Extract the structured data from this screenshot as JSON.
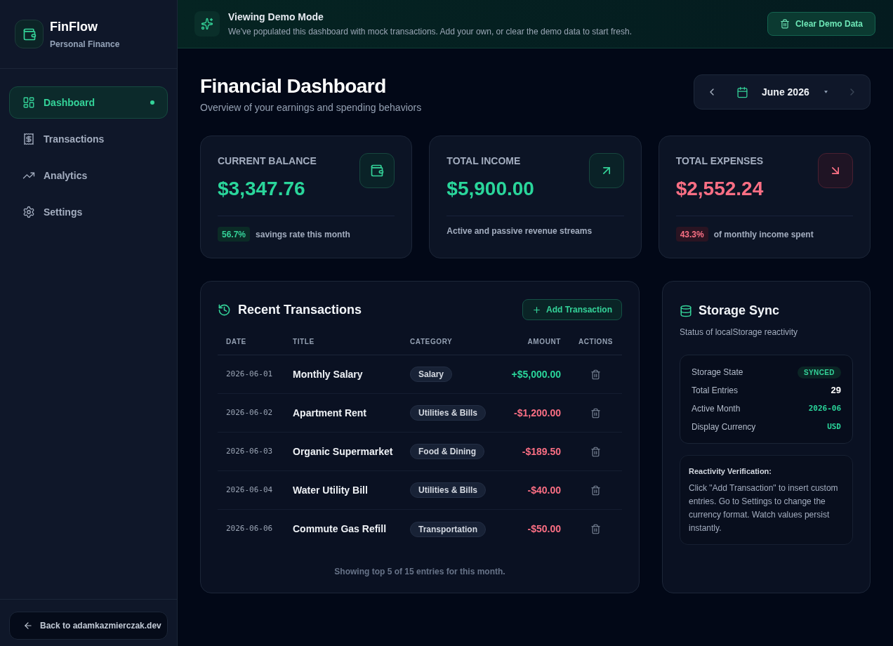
{
  "sidebar": {
    "brand": {
      "name": "FinFlow",
      "tagline": "Personal Finance"
    },
    "nav": [
      {
        "label": "Dashboard",
        "selected": true
      },
      {
        "label": "Transactions",
        "selected": false
      },
      {
        "label": "Analytics",
        "selected": false
      },
      {
        "label": "Settings",
        "selected": false
      }
    ],
    "back_link": "Back to adamkazmierczak.dev"
  },
  "banner": {
    "title": "Viewing Demo Mode",
    "message": "We've populated this dashboard with mock transactions. Add your own, or clear the demo data to start fresh.",
    "button": "Clear Demo Data"
  },
  "header": {
    "title": "Financial Dashboard",
    "subtitle": "Overview of your earnings and spending behaviors",
    "month_picker": {
      "label": "June 2026",
      "prev_disabled": false,
      "next_disabled": true
    }
  },
  "stats": [
    {
      "label": "CURRENT BALANCE",
      "value": "$3,347.76",
      "kind": "positive",
      "badge": "56.7%",
      "note": "savings rate this month"
    },
    {
      "label": "TOTAL INCOME",
      "value": "$5,900.00",
      "kind": "positive",
      "note": "Active and passive revenue streams"
    },
    {
      "label": "TOTAL EXPENSES",
      "value": "$2,552.24",
      "kind": "negative",
      "badge": "43.3%",
      "note": "of monthly income spent"
    }
  ],
  "transactions": {
    "title": "Recent Transactions",
    "add_button": "Add Transaction",
    "columns": [
      "DATE",
      "TITLE",
      "CATEGORY",
      "AMOUNT",
      "ACTIONS"
    ],
    "rows": [
      {
        "date": "2026-06-01",
        "title": "Monthly Salary",
        "category": "Salary",
        "amount": "+$5,000.00",
        "kind": "income"
      },
      {
        "date": "2026-06-02",
        "title": "Apartment Rent",
        "category": "Utilities & Bills",
        "amount": "-$1,200.00",
        "kind": "expense"
      },
      {
        "date": "2026-06-03",
        "title": "Organic Supermarket",
        "category": "Food & Dining",
        "amount": "-$189.50",
        "kind": "expense"
      },
      {
        "date": "2026-06-04",
        "title": "Water Utility Bill",
        "category": "Utilities & Bills",
        "amount": "-$40.00",
        "kind": "expense"
      },
      {
        "date": "2026-06-06",
        "title": "Commute Gas Refill",
        "category": "Transportation",
        "amount": "-$50.00",
        "kind": "expense"
      }
    ],
    "footer": "Showing top 5 of 15 entries for this month."
  },
  "storage": {
    "title": "Storage Sync",
    "subtitle": "Status of localStorage reactivity",
    "rows": [
      {
        "label": "Storage State",
        "value": "SYNCED",
        "kind": "badge"
      },
      {
        "label": "Total Entries",
        "value": "29",
        "kind": "number"
      },
      {
        "label": "Active Month",
        "value": "2026-06",
        "kind": "code"
      },
      {
        "label": "Display Currency",
        "value": "USD",
        "kind": "code"
      }
    ],
    "note": {
      "title": "Reactivity Verification:",
      "body": "Click \"Add Transaction\" to insert custom entries. Go to Settings to change the currency format. Watch values persist instantly."
    }
  }
}
